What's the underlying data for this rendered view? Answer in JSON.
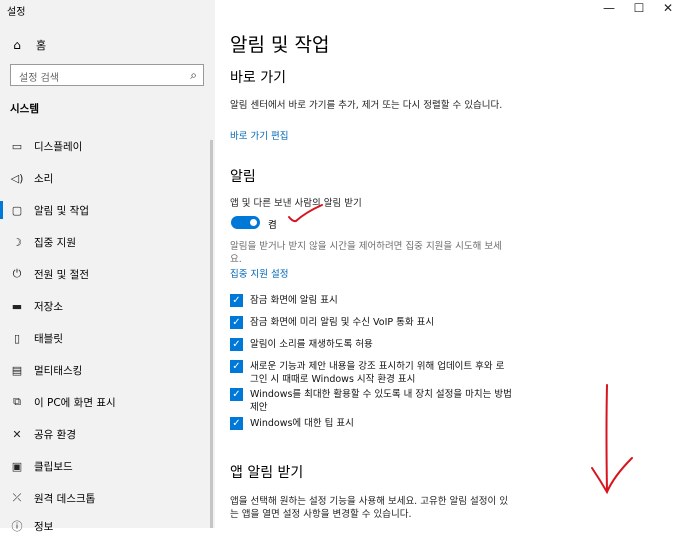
{
  "app": {
    "title": "설정"
  },
  "window": {
    "minimize": "—",
    "maximize": "☐",
    "close": "✕"
  },
  "sidebar": {
    "home": "홈",
    "search_placeholder": "설정 검색",
    "group": "시스템",
    "items": [
      {
        "label": "디스플레이",
        "icon": "display-icon"
      },
      {
        "label": "소리",
        "icon": "speaker-icon"
      },
      {
        "label": "알림 및 작업",
        "icon": "notification-icon",
        "active": true
      },
      {
        "label": "집중 지원",
        "icon": "moon-icon"
      },
      {
        "label": "전원 및 절전",
        "icon": "power-icon"
      },
      {
        "label": "저장소",
        "icon": "storage-icon"
      },
      {
        "label": "태블릿",
        "icon": "tablet-icon"
      },
      {
        "label": "멀티태스킹",
        "icon": "multitasking-icon"
      },
      {
        "label": "이 PC에 화면 표시",
        "icon": "project-icon"
      },
      {
        "label": "공유 환경",
        "icon": "share-icon"
      },
      {
        "label": "클립보드",
        "icon": "clipboard-icon"
      },
      {
        "label": "원격 데스크톱",
        "icon": "remote-desktop-icon"
      },
      {
        "label": "정보",
        "icon": "info-icon"
      }
    ]
  },
  "main": {
    "title": "알림 및 작업",
    "quick_actions": {
      "heading": "바로 가기",
      "desc": "알림 센터에서 바로 가기를 추가, 제거 또는 다시 정렬할 수 있습니다.",
      "link": "바로 가기 편집"
    },
    "notifications": {
      "heading": "알림",
      "toggle_label": "앱 및 다른 보낸 사람의 알림 받기",
      "toggle_state": "켬",
      "toggle_on": true,
      "focus_desc_1": "알림을 받거나 받지 않을 시간을 제어하려면 집중 지원을 시도해 보세",
      "focus_desc_2": "요.",
      "focus_link": "집중 지원 설정",
      "checkboxes": [
        {
          "lines": [
            "잠금 화면에 알림 표시"
          ],
          "checked": true
        },
        {
          "lines": [
            "잠금 화면에 미리 알림 및 수신 VoIP 통화 표시"
          ],
          "checked": true
        },
        {
          "lines": [
            "알림이 소리를 재생하도록 허용"
          ],
          "checked": true
        },
        {
          "lines": [
            "새로운 기능과 제안 내용을 강조 표시하기 위해 업데이트 후와 로",
            "그인 시 때때로 Windows 시작 환경 표시"
          ],
          "checked": true
        },
        {
          "lines": [
            "Windows를 최대한 활용할 수 있도록 내 장치 설정을 마치는 방법",
            "제안"
          ],
          "checked": true
        },
        {
          "lines": [
            "Windows에 대한 팁 표시"
          ],
          "checked": true
        }
      ]
    },
    "app_notifications": {
      "heading": "앱 알림 받기",
      "desc_1": "앱을 선택해 원하는 설정 기능을 사용해 보세요. 고유한 알림 설정이 있",
      "desc_2": "는 앱을 열면 설정 사항을 변경할 수 있습니다."
    }
  },
  "colors": {
    "accent": "#0078d7",
    "link": "#0067b8",
    "annotation": "#d8141f",
    "sidebar_bg": "#f2f2f2"
  }
}
